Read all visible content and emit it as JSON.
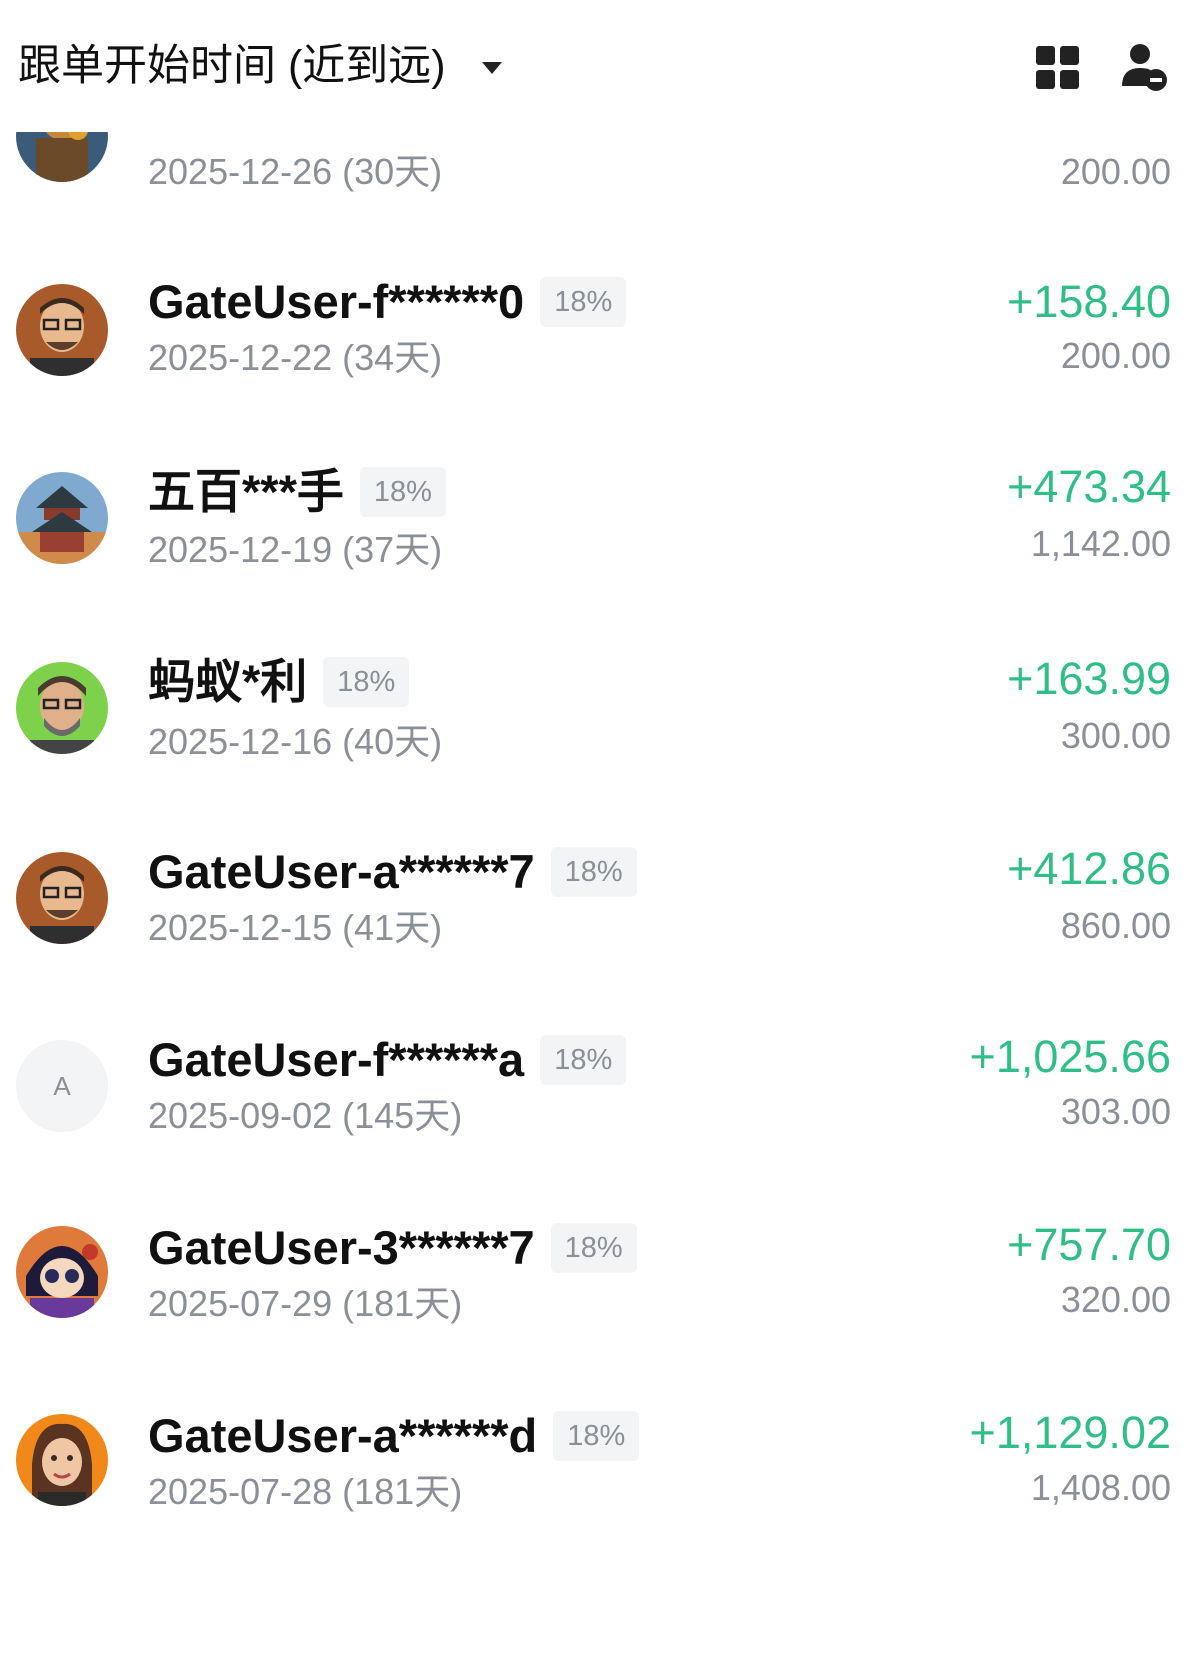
{
  "header": {
    "sort_label": "跟单开始时间 (近到远)",
    "grid_icon": "grid-view-icon",
    "user_icon": "user-remove-icon"
  },
  "colors": {
    "profit_green": "#2fbf86",
    "muted_gray": "#8a8f98",
    "badge_bg": "#f3f4f6"
  },
  "rows": [
    {
      "name": "",
      "badge": "",
      "date": "2025-12-26 (30天)",
      "pnl": "",
      "amount": "200.00",
      "avatar": "bitcoin-art-avatar"
    },
    {
      "name": "GateUser-f******0",
      "badge": "18%",
      "date": "2025-12-22 (34天)",
      "pnl": "+158.40",
      "amount": "200.00",
      "avatar": "man-glasses-avatar"
    },
    {
      "name": "五百***手",
      "badge": "18%",
      "date": "2025-12-19 (37天)",
      "pnl": "+473.34",
      "amount": "1,142.00",
      "avatar": "pagoda-avatar"
    },
    {
      "name": "蚂蚁*利",
      "badge": "18%",
      "date": "2025-12-16 (40天)",
      "pnl": "+163.99",
      "amount": "300.00",
      "avatar": "bearded-man-avatar"
    },
    {
      "name": "GateUser-a******7",
      "badge": "18%",
      "date": "2025-12-15 (41天)",
      "pnl": "+412.86",
      "amount": "860.00",
      "avatar": "man-glasses-avatar"
    },
    {
      "name": "GateUser-f******a",
      "badge": "18%",
      "date": "2025-09-02 (145天)",
      "pnl": "+1,025.66",
      "amount": "303.00",
      "avatar_letter": "A"
    },
    {
      "name": "GateUser-3******7",
      "badge": "18%",
      "date": "2025-07-29 (181天)",
      "pnl": "+757.70",
      "amount": "320.00",
      "avatar": "anime-girl-avatar"
    },
    {
      "name": "GateUser-a******d",
      "badge": "18%",
      "date": "2025-07-28 (181天)",
      "pnl": "+1,129.02",
      "amount": "1,408.00",
      "avatar": "woman-avatar"
    }
  ]
}
